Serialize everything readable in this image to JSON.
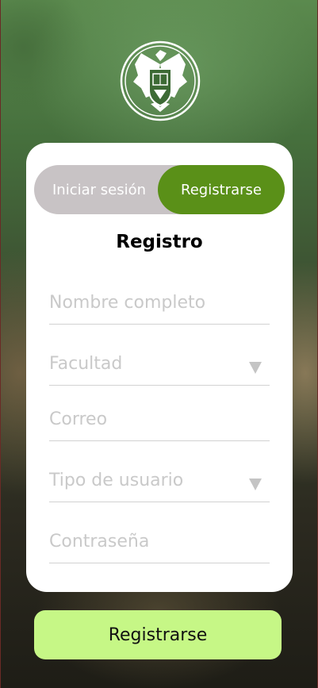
{
  "tabs": {
    "login_label": "Iniciar sesión",
    "register_label": "Registrarse",
    "active": "Registrarse"
  },
  "form": {
    "title": "Registro",
    "fields": [
      {
        "placeholder": "Nombre completo",
        "type": "text"
      },
      {
        "placeholder": "Facultad",
        "type": "select"
      },
      {
        "placeholder": "Correo",
        "type": "text"
      },
      {
        "placeholder": "Tipo de usuario",
        "type": "select"
      },
      {
        "placeholder": "Contraseña",
        "type": "password"
      }
    ]
  },
  "submit": {
    "label": "Registrarse"
  },
  "colors": {
    "accent_active_tab": "#5a9018",
    "toggle_background": "#c8c3c5",
    "submit_background": "#c6f786",
    "card_background": "#ffffff"
  },
  "icons": {
    "logo": "eagle-crest-icon",
    "dropdown": "triangle-down-icon"
  }
}
